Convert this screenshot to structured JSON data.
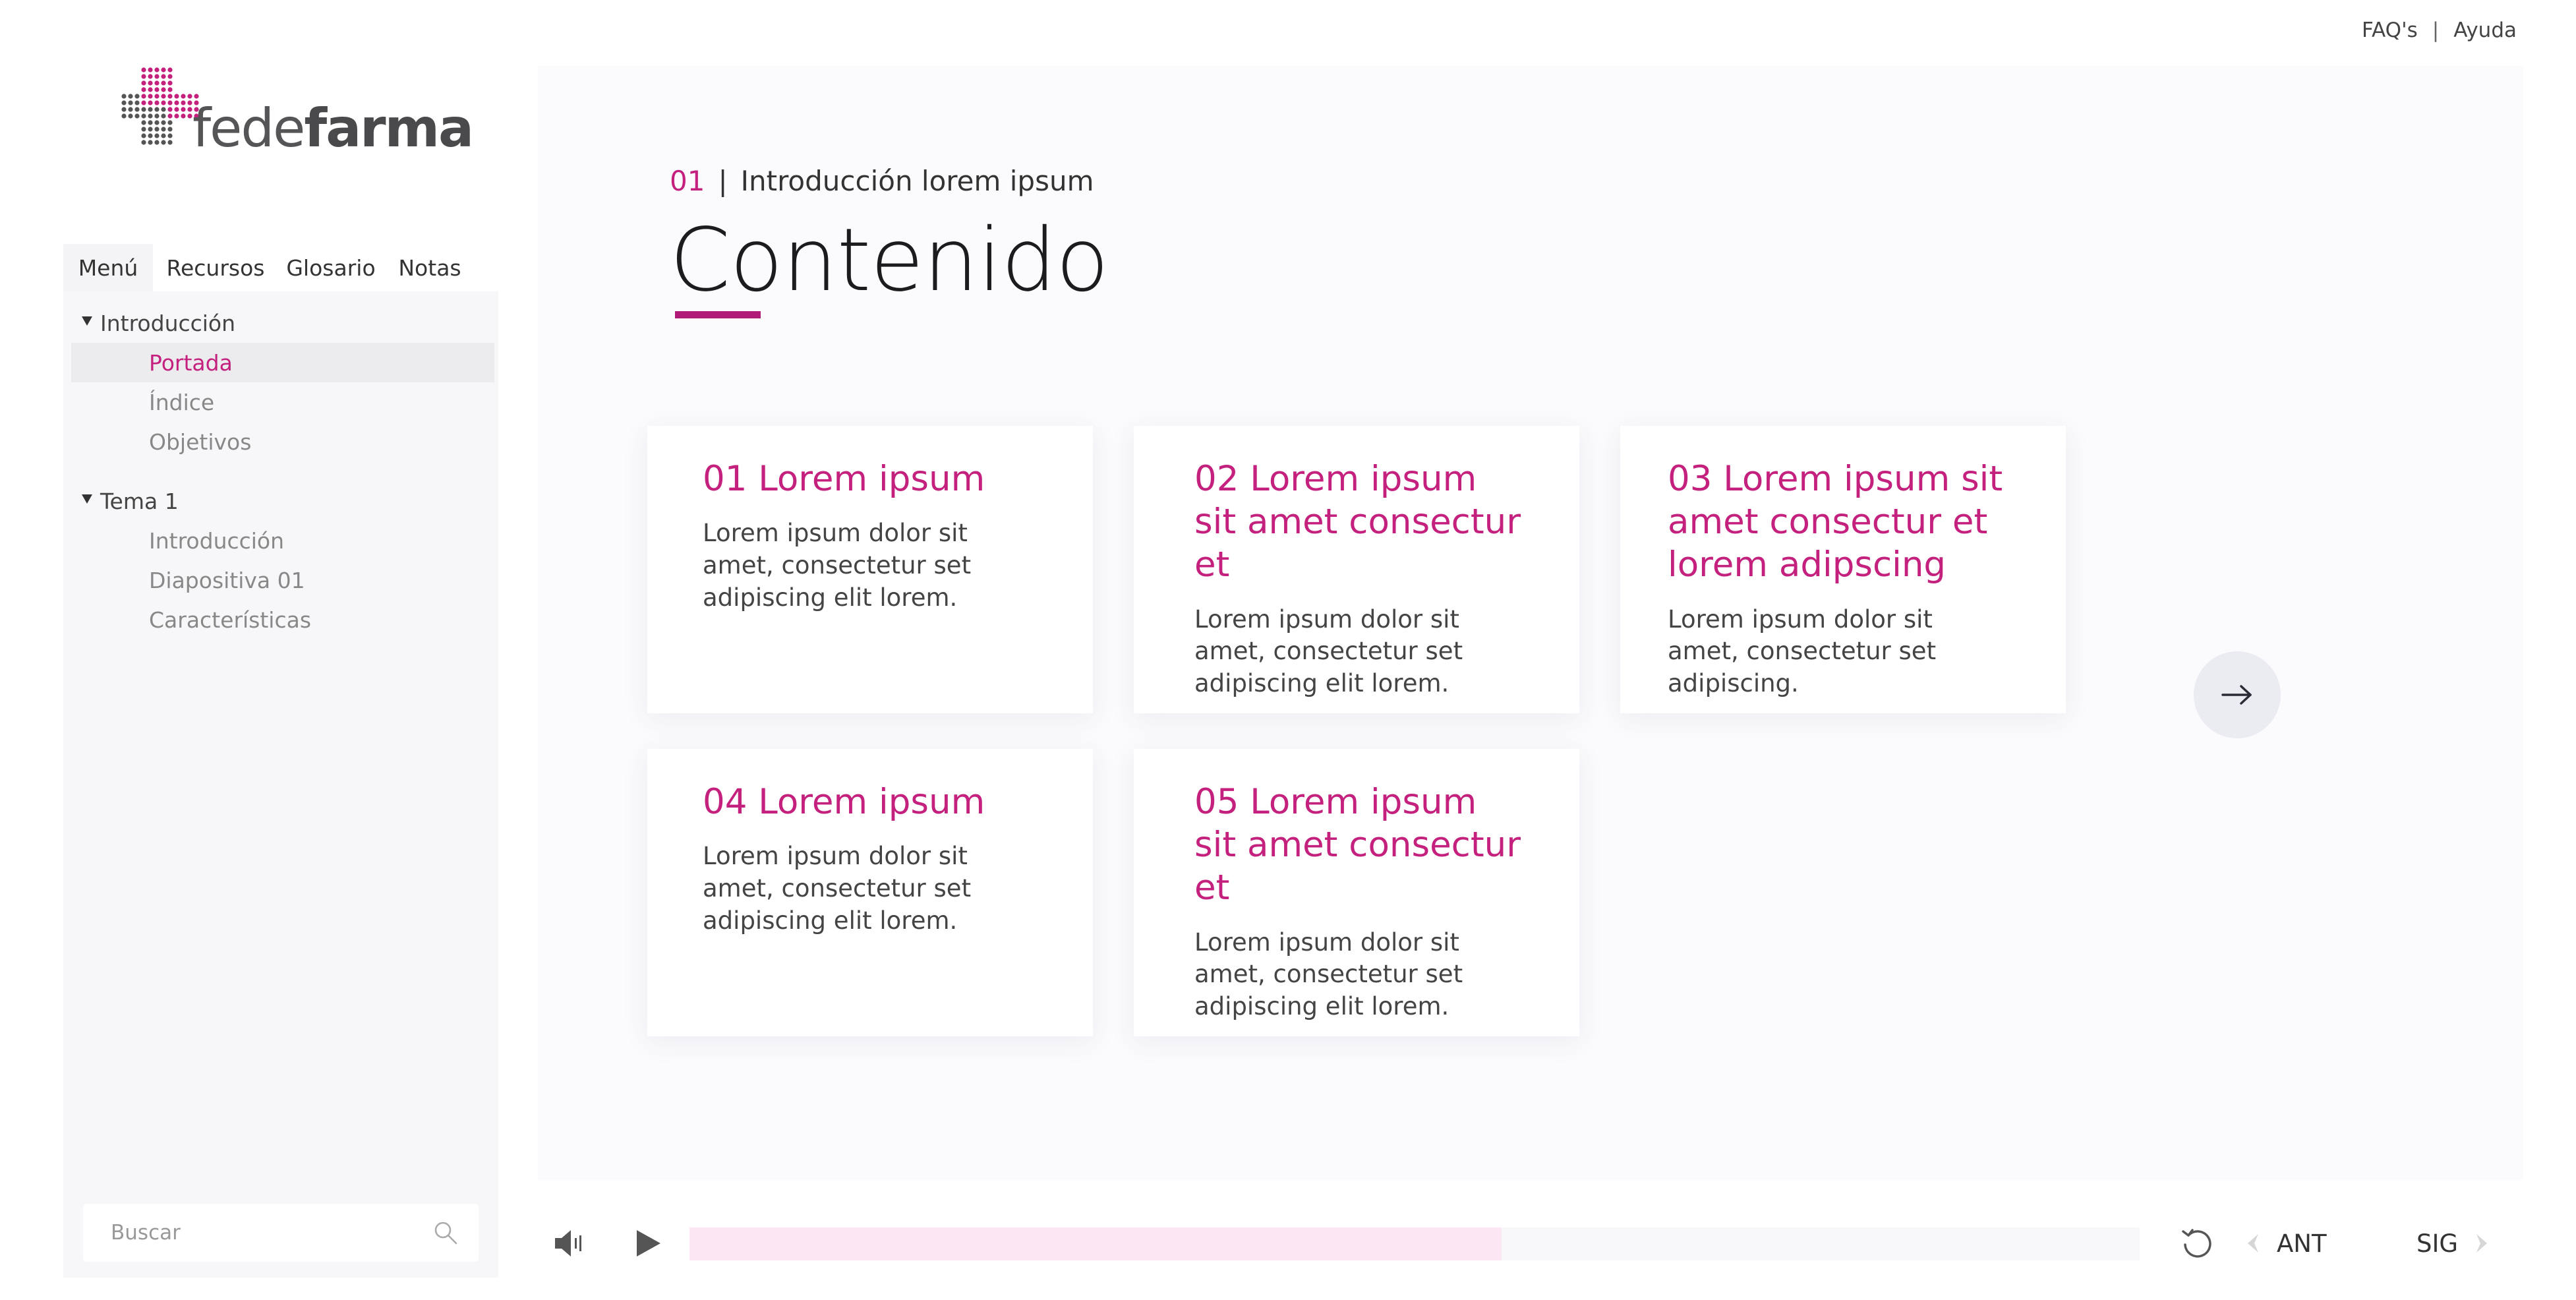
{
  "top_links": {
    "faqs": "FAQ's",
    "separator": "|",
    "help": "Ayuda"
  },
  "logo": {
    "text_light": "fede",
    "text_bold": "farma",
    "accent_color": "#c4207d"
  },
  "sidebar": {
    "tabs": [
      {
        "label": "Menú",
        "active": true
      },
      {
        "label": "Recursos",
        "active": false
      },
      {
        "label": "Glosario",
        "active": false
      },
      {
        "label": "Notas",
        "active": false
      }
    ],
    "groups": [
      {
        "label": "Introducción",
        "expanded": true,
        "items": [
          {
            "label": "Portada",
            "active": true
          },
          {
            "label": "Índice",
            "active": false
          },
          {
            "label": "Objetivos",
            "active": false
          }
        ]
      },
      {
        "label": "Tema 1",
        "expanded": true,
        "items": [
          {
            "label": "Introducción",
            "active": false
          },
          {
            "label": "Diapositiva 01",
            "active": false
          },
          {
            "label": "Características",
            "active": false
          }
        ]
      }
    ],
    "search": {
      "placeholder": "Buscar",
      "icon": "search-icon"
    }
  },
  "main": {
    "section_number": "01",
    "section_separator": "|",
    "section_title": "Introducción lorem ipsum",
    "page_title": "Contenido",
    "cards": [
      {
        "title": "01 Lorem ipsum",
        "body": "Lorem ipsum dolor sit amet, consectetur set adipiscing elit lorem."
      },
      {
        "title": "02 Lorem ipsum sit amet consectur et",
        "body": "Lorem ipsum dolor sit amet, consectetur set adipiscing elit lorem."
      },
      {
        "title": "03 Lorem ipsum sit amet consectur et lorem adipscing",
        "body": "Lorem ipsum dolor sit amet, consectetur set adipiscing."
      },
      {
        "title": "04 Lorem ipsum",
        "body": "Lorem ipsum dolor sit amet, consectetur set adipiscing elit lorem."
      },
      {
        "title": "05 Lorem ipsum sit amet consectur et",
        "body": "Lorem ipsum dolor sit amet, consectetur set adipiscing elit lorem."
      }
    ],
    "next_arrow_icon": "arrow-right-icon"
  },
  "player": {
    "volume_icon": "volume-icon",
    "play_icon": "play-icon",
    "progress_fraction": 0.56,
    "progress_color": "#fce6f4",
    "replay_icon": "replay-icon",
    "prev_label": "ANT",
    "next_label": "SIG"
  },
  "colors": {
    "accent": "#c4207d",
    "underline": "#b01b78",
    "sidebar_bg": "#f7f7f9",
    "main_bg": "#fbfbfd"
  }
}
